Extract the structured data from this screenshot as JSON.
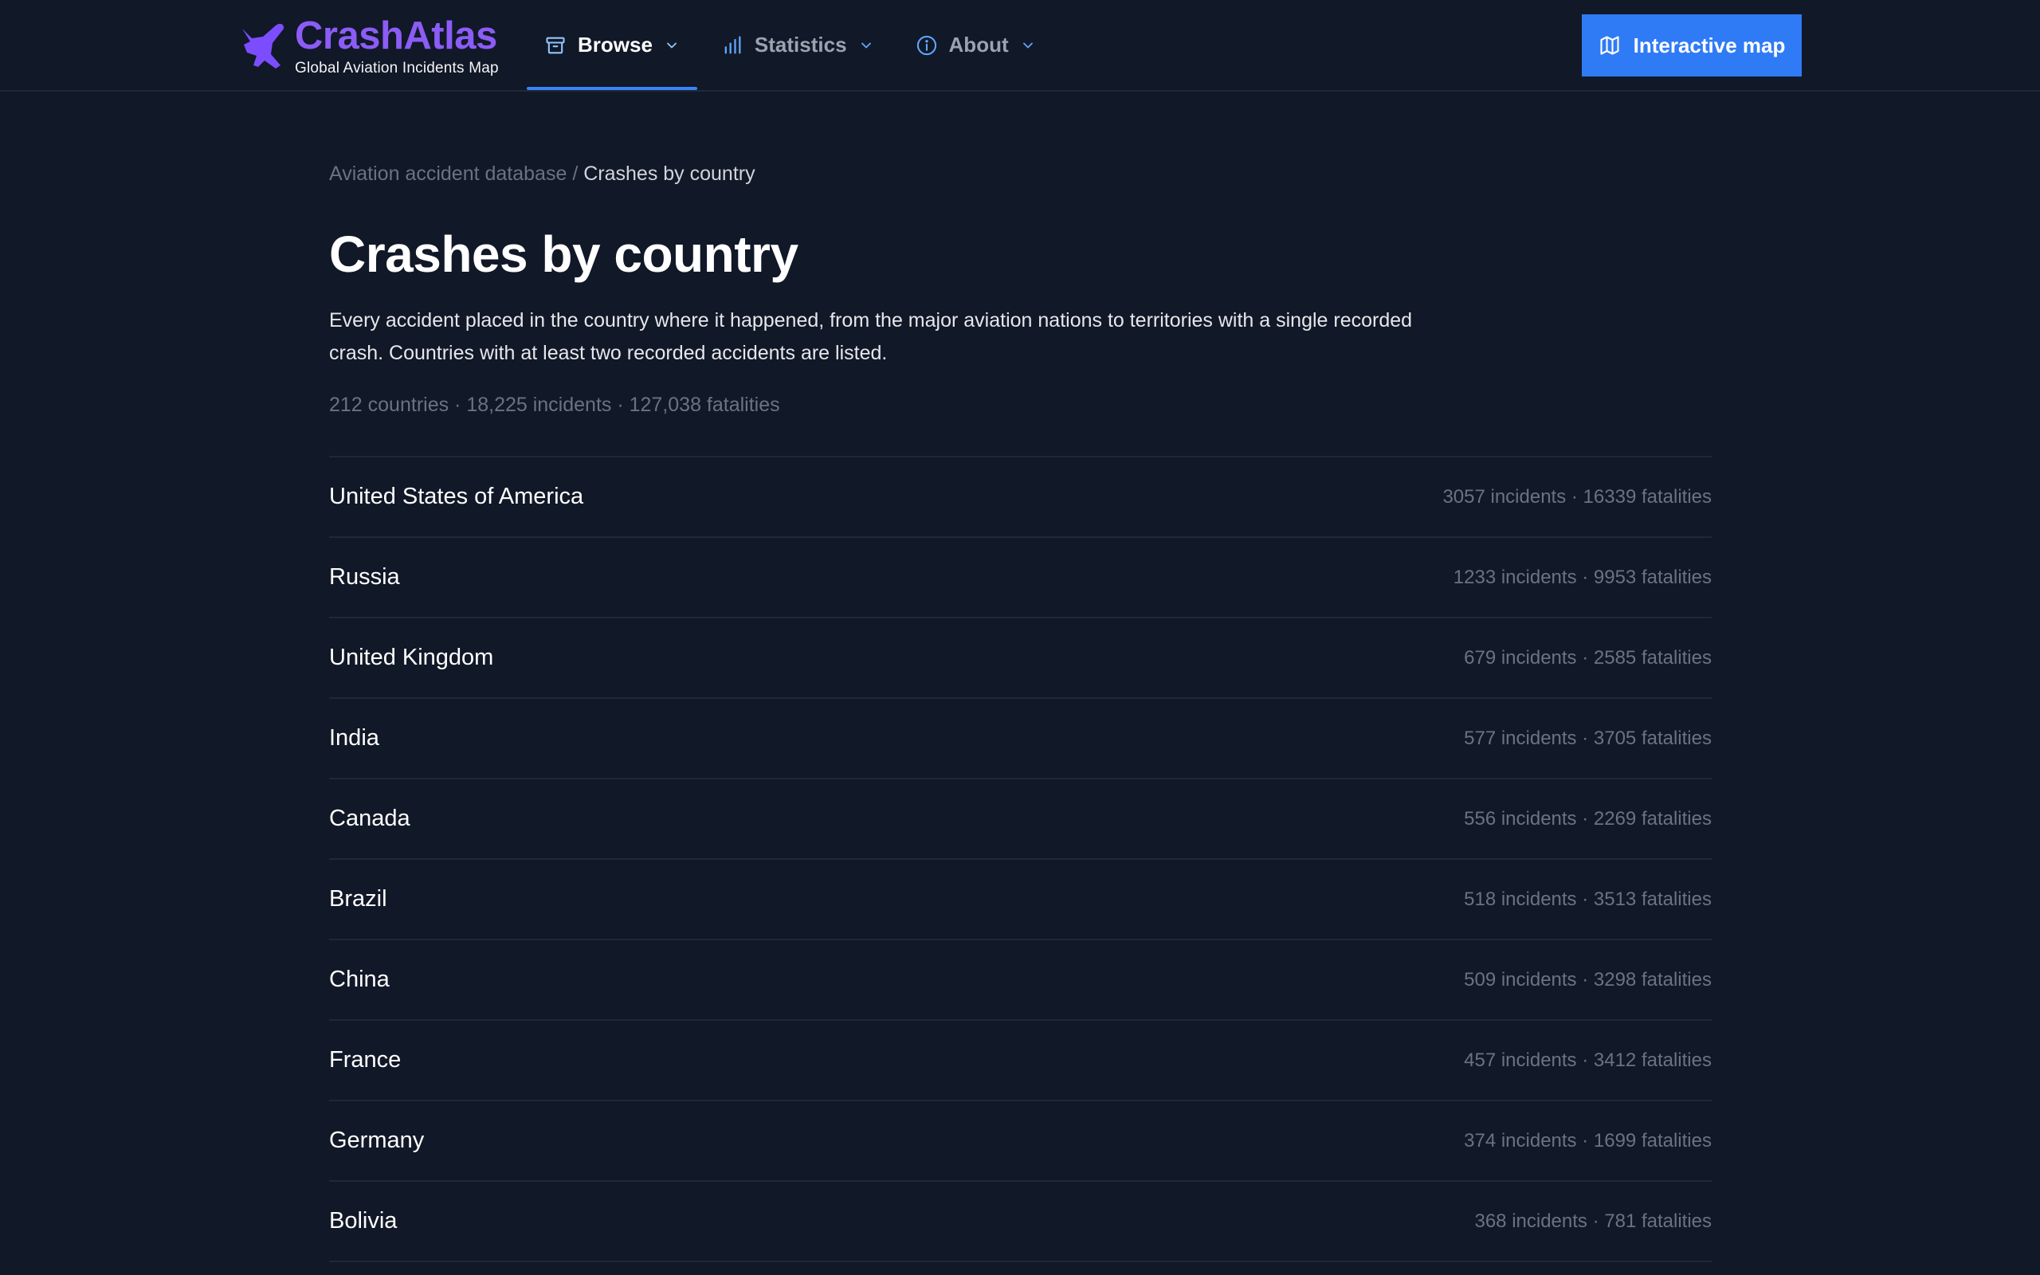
{
  "brand": {
    "name": "CrashAtlas",
    "tagline": "Global Aviation Incidents Map",
    "accent_color": "#8b5cf6"
  },
  "nav": {
    "items": [
      {
        "label": "Browse",
        "icon": "archive-box-icon",
        "active": true
      },
      {
        "label": "Statistics",
        "icon": "bar-chart-icon",
        "active": false
      },
      {
        "label": "About",
        "icon": "info-circle-icon",
        "active": false
      }
    ],
    "cta": {
      "label": "Interactive map",
      "icon": "map-icon",
      "color": "#2f7bf6"
    }
  },
  "breadcrumb": {
    "parent": "Aviation accident database",
    "separator": "/",
    "current": "Crashes by country"
  },
  "page": {
    "title": "Crashes by country",
    "intro": "Every accident placed in the country where it happened, from the major aviation nations to territories with a single recorded crash. Countries with at least two recorded accidents are listed.",
    "summary": "212 countries · 18,225 incidents · 127,038 fatalities"
  },
  "countries": [
    {
      "name": "United States of America",
      "stats": "3057 incidents · 16339 fatalities"
    },
    {
      "name": "Russia",
      "stats": "1233 incidents · 9953 fatalities"
    },
    {
      "name": "United Kingdom",
      "stats": "679 incidents · 2585 fatalities"
    },
    {
      "name": "India",
      "stats": "577 incidents · 3705 fatalities"
    },
    {
      "name": "Canada",
      "stats": "556 incidents · 2269 fatalities"
    },
    {
      "name": "Brazil",
      "stats": "518 incidents · 3513 fatalities"
    },
    {
      "name": "China",
      "stats": "509 incidents · 3298 fatalities"
    },
    {
      "name": "France",
      "stats": "457 incidents · 3412 fatalities"
    },
    {
      "name": "Germany",
      "stats": "374 incidents · 1699 fatalities"
    },
    {
      "name": "Bolivia",
      "stats": "368 incidents · 781 fatalities"
    }
  ]
}
